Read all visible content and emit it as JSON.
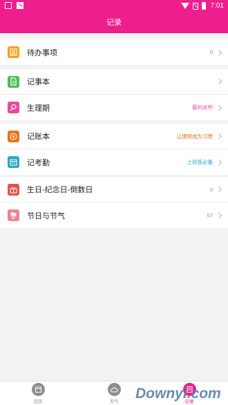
{
  "status_bar": {
    "time": "7:01"
  },
  "header": {
    "title": "记录"
  },
  "groups": [
    {
      "rows": [
        {
          "label": "待办事项",
          "value": "0",
          "value_color": "#888888",
          "icon": "list-icon",
          "icon_color": "#f3a21b"
        }
      ]
    },
    {
      "rows": [
        {
          "label": "记事本",
          "value": "",
          "value_color": "#888888",
          "icon": "notebook-icon",
          "icon_color": "#4cbf54"
        },
        {
          "label": "生理期",
          "value": "最的关怀",
          "value_color": "#e94a9c",
          "icon": "female-icon",
          "icon_color": "#e94a9c"
        }
      ]
    },
    {
      "rows": [
        {
          "label": "记账本",
          "value": "让理财成为习惯",
          "value_color": "#e07020",
          "icon": "yen-icon",
          "icon_color": "#e8741b"
        },
        {
          "label": "记考勤",
          "value": "上班族必备",
          "value_color": "#2aa8c2",
          "icon": "calendar-icon",
          "icon_color": "#2aa8c2"
        }
      ]
    },
    {
      "rows": [
        {
          "label": "生日-纪念日-倒数日",
          "value": "0",
          "value_color": "#888888",
          "icon": "gift-icon",
          "icon_color": "#e2534f"
        },
        {
          "label": "节日与节气",
          "value": "57",
          "value_color": "#888888",
          "icon": "balloon-icon",
          "icon_color": "#f0838e"
        }
      ]
    }
  ],
  "tabs": [
    {
      "label": "日历",
      "icon": "calendar-tab-icon",
      "active": false
    },
    {
      "label": "天气",
      "icon": "weather-tab-icon",
      "active": false
    },
    {
      "label": "记录",
      "icon": "record-tab-icon",
      "active": true
    }
  ],
  "watermark": {
    "text": "Downyi",
    "dot": ".",
    "suffix": "com"
  }
}
